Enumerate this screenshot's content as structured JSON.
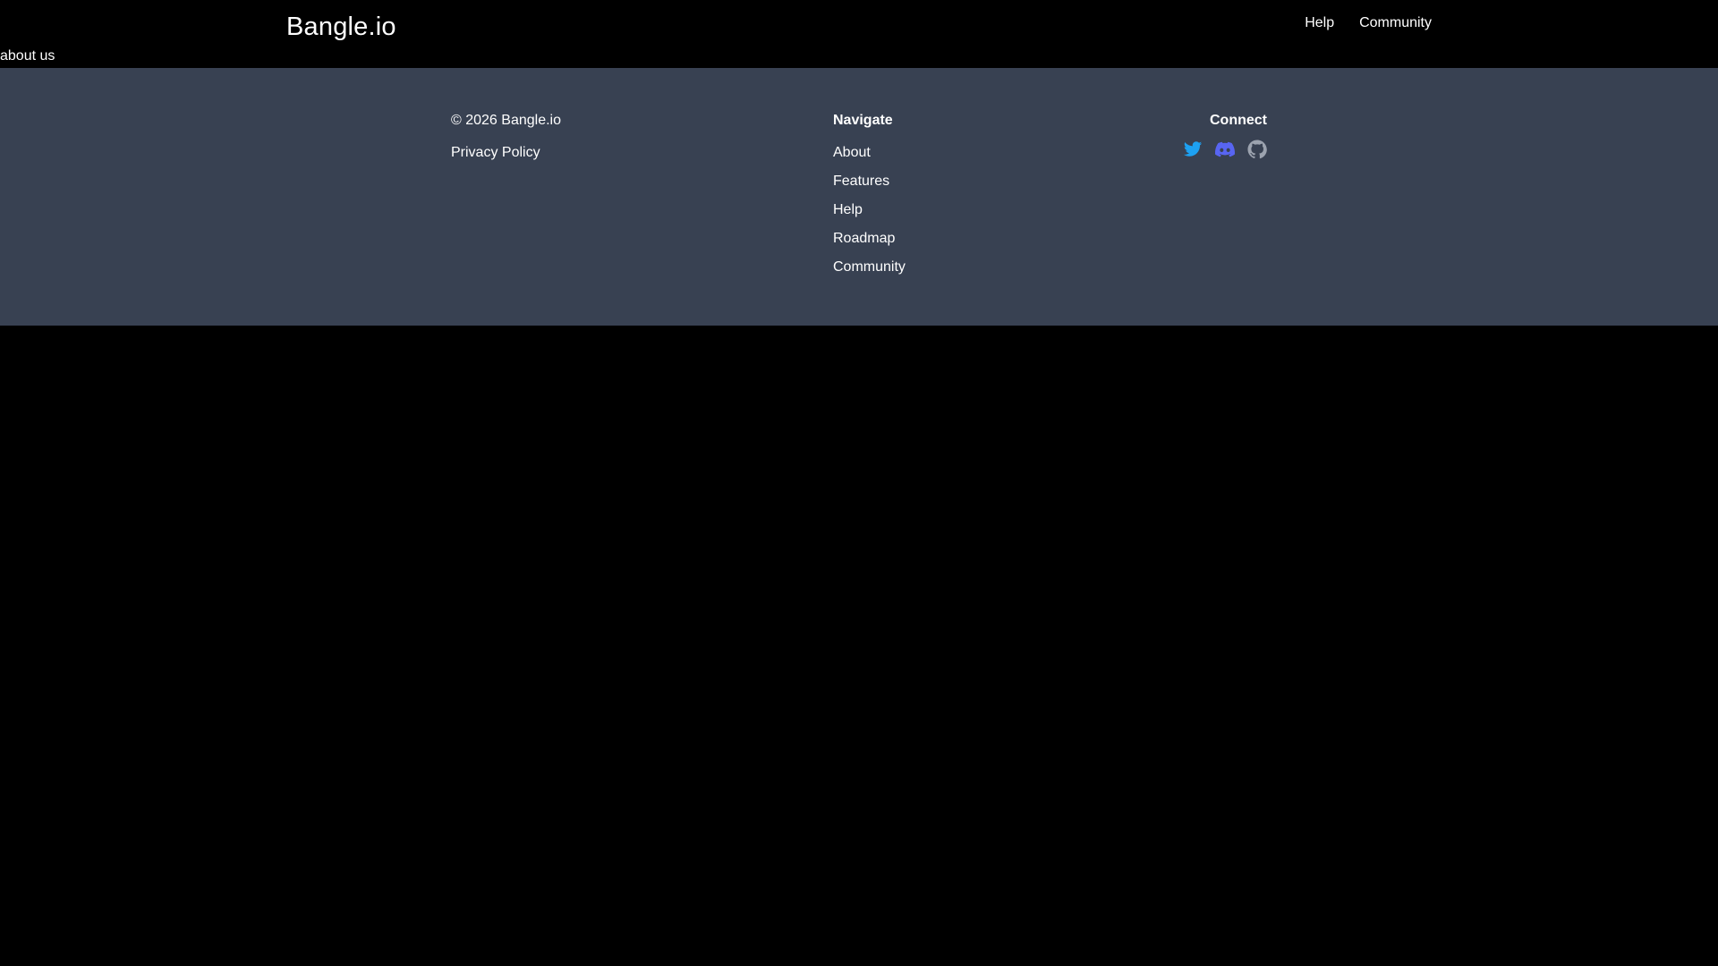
{
  "header": {
    "brand": "Bangle.io",
    "nav": [
      {
        "label": "Help"
      },
      {
        "label": "Community"
      }
    ],
    "about_link": "about us"
  },
  "footer": {
    "copyright": "© 2026 Bangle.io",
    "privacy_link": "Privacy Policy",
    "navigate": {
      "title": "Navigate",
      "links": [
        {
          "label": "About"
        },
        {
          "label": "Features"
        },
        {
          "label": "Help"
        },
        {
          "label": "Roadmap"
        },
        {
          "label": "Community"
        }
      ]
    },
    "connect": {
      "title": "Connect",
      "icons": [
        {
          "name": "twitter-icon",
          "color": "#1DA1F2"
        },
        {
          "name": "discord-icon",
          "color": "#5865F2"
        },
        {
          "name": "github-icon",
          "color": "#9CA3AF"
        }
      ]
    }
  }
}
